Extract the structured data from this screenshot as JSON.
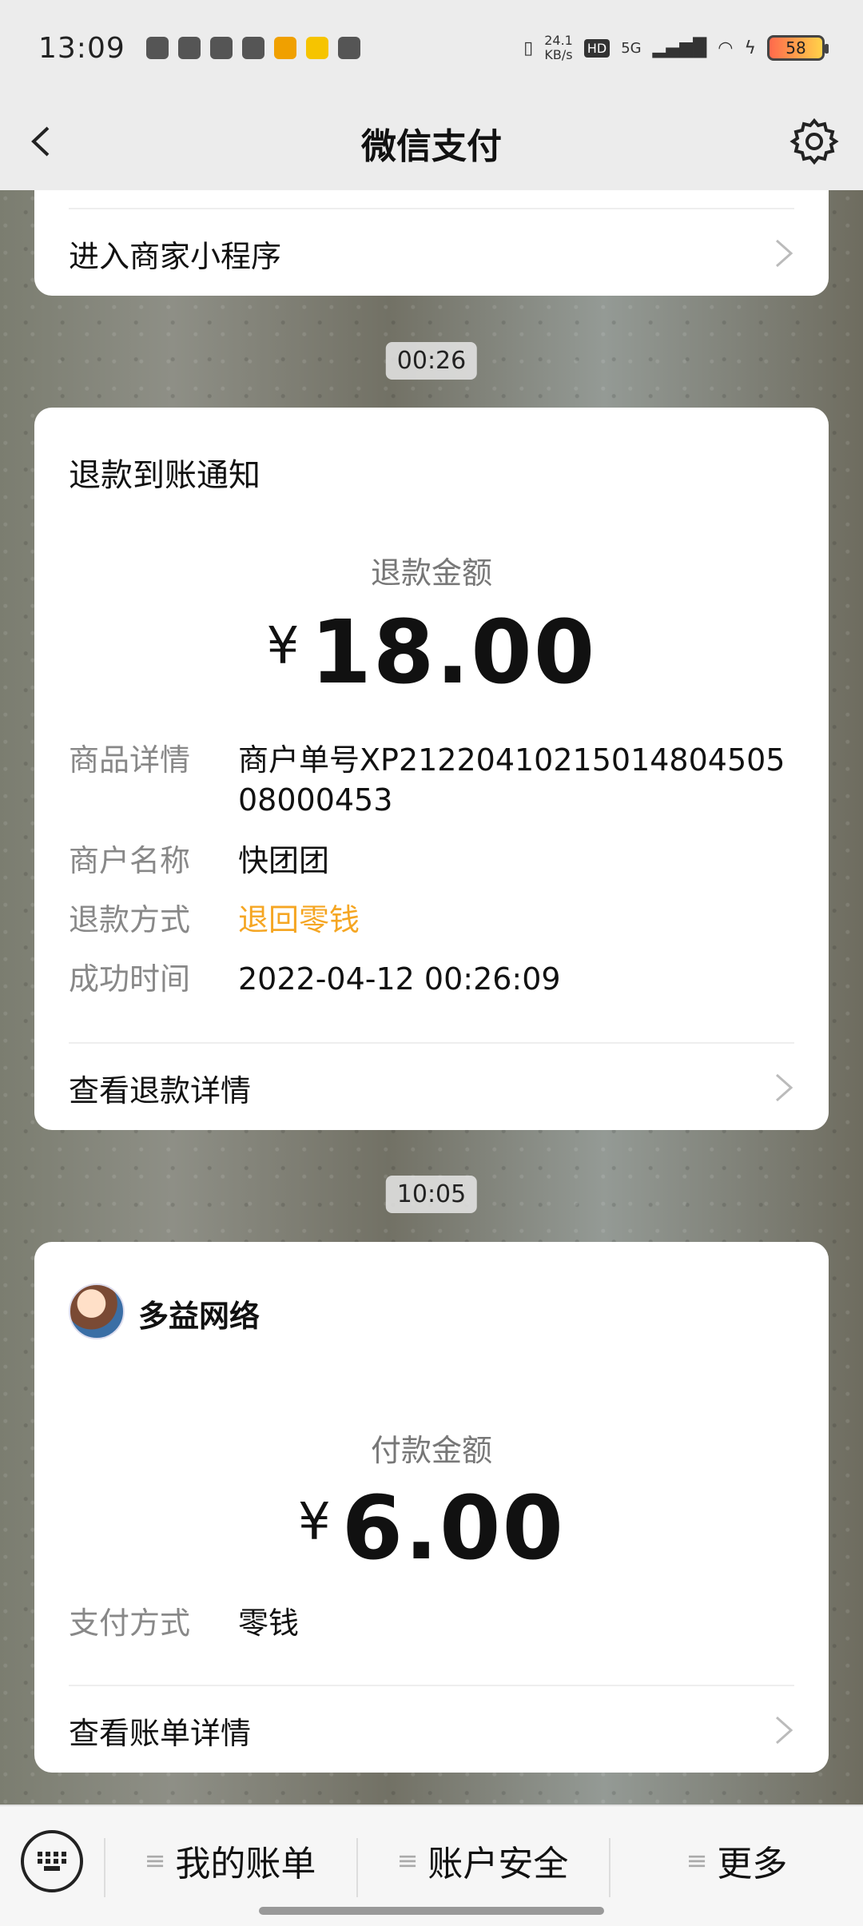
{
  "status_bar": {
    "time": "13:09",
    "speed": "24.1",
    "speed_unit": "KB/s",
    "hd": "HD",
    "network": "5G",
    "battery": "58",
    "icons": [
      "wechat-icon",
      "circle-app-icon",
      "crown-icon",
      "weibo-icon",
      "app-icon",
      "kuaipa-icon",
      "link-icon",
      "vibrate-icon",
      "signal-icon",
      "wifi-icon",
      "charging-icon",
      "battery-icon"
    ]
  },
  "nav": {
    "title": "微信支付"
  },
  "top_card": {
    "link_label": "进入商家小程序"
  },
  "msg1": {
    "time": "00:26",
    "title": "退款到账通知",
    "amount_label": "退款金额",
    "currency": "¥",
    "amount": "18.00",
    "fields": [
      {
        "key": "商品详情",
        "value": "商户单号XP2122041021501480450508000453"
      },
      {
        "key": "商户名称",
        "value": "快团团"
      },
      {
        "key": "退款方式",
        "value": "退回零钱"
      },
      {
        "key": "成功时间",
        "value": "2022-04-12 00:26:09"
      }
    ],
    "link_label": "查看退款详情"
  },
  "msg2": {
    "time": "10:05",
    "merchant": "多益网络",
    "amount_label": "付款金额",
    "currency": "¥",
    "amount": "6.00",
    "fields": [
      {
        "key": "支付方式",
        "value": "零钱"
      }
    ],
    "link_label": "查看账单详情"
  },
  "bottom_menu": {
    "items": [
      "我的账单",
      "账户安全",
      "更多"
    ],
    "menu_glyph": "≡"
  },
  "colors": {
    "highlight": "#f5a623",
    "navbar_bg": "#ececec"
  }
}
